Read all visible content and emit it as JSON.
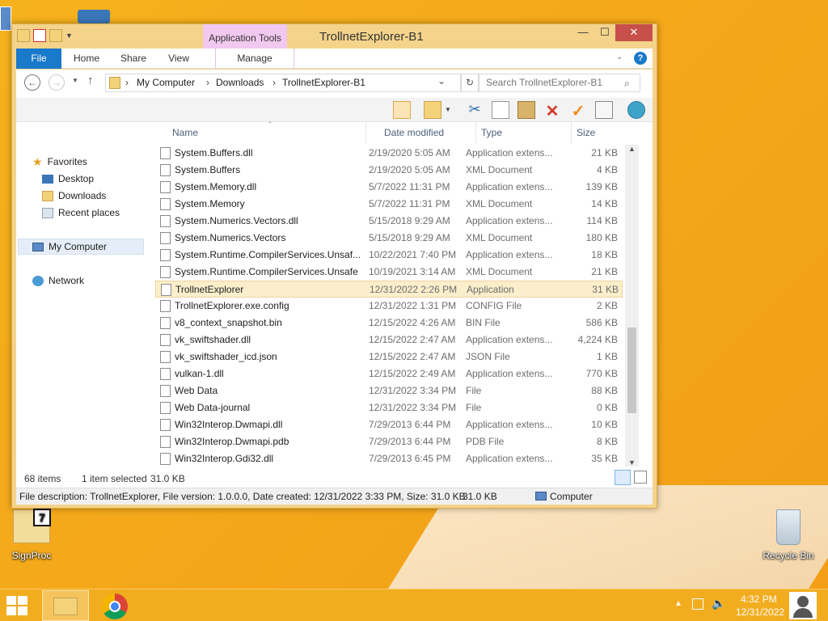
{
  "desktop": {
    "icons": [
      {
        "label": "SignProc"
      },
      {
        "label": "Recycle Bin"
      }
    ]
  },
  "window": {
    "title": "TrollnetExplorer-B1",
    "context_tab": "Application Tools",
    "ribbon_tabs": [
      "File",
      "Home",
      "Share",
      "View",
      "Manage"
    ],
    "controls": {
      "minimize": "—",
      "maximize": "☐",
      "close": "✕"
    }
  },
  "address": {
    "crumbs": [
      "My Computer",
      "Downloads",
      "TrollnetExplorer-B1"
    ],
    "search_placeholder": "Search TrollnetExplorer-B1"
  },
  "navpane": {
    "favorites": "Favorites",
    "items": [
      "Desktop",
      "Downloads",
      "Recent places"
    ],
    "computer": "My Computer",
    "network": "Network"
  },
  "columns": {
    "name": "Name",
    "date": "Date modified",
    "type": "Type",
    "size": "Size"
  },
  "files": [
    {
      "name": "System.Buffers.dll",
      "date": "2/19/2020 5:05 AM",
      "type": "Application extens...",
      "size": "21 KB"
    },
    {
      "name": "System.Buffers",
      "date": "2/19/2020 5:05 AM",
      "type": "XML Document",
      "size": "4 KB"
    },
    {
      "name": "System.Memory.dll",
      "date": "5/7/2022 11:31 PM",
      "type": "Application extens...",
      "size": "139 KB"
    },
    {
      "name": "System.Memory",
      "date": "5/7/2022 11:31 PM",
      "type": "XML Document",
      "size": "14 KB"
    },
    {
      "name": "System.Numerics.Vectors.dll",
      "date": "5/15/2018 9:29 AM",
      "type": "Application extens...",
      "size": "114 KB"
    },
    {
      "name": "System.Numerics.Vectors",
      "date": "5/15/2018 9:29 AM",
      "type": "XML Document",
      "size": "180 KB"
    },
    {
      "name": "System.Runtime.CompilerServices.Unsaf...",
      "date": "10/22/2021 7:40 PM",
      "type": "Application extens...",
      "size": "18 KB"
    },
    {
      "name": "System.Runtime.CompilerServices.Unsafe",
      "date": "10/19/2021 3:14 AM",
      "type": "XML Document",
      "size": "21 KB"
    },
    {
      "name": "TrollnetExplorer",
      "date": "12/31/2022 2:26 PM",
      "type": "Application",
      "size": "31 KB"
    },
    {
      "name": "TrollnetExplorer.exe.config",
      "date": "12/31/2022 1:31 PM",
      "type": "CONFIG File",
      "size": "2 KB"
    },
    {
      "name": "v8_context_snapshot.bin",
      "date": "12/15/2022 4:26 AM",
      "type": "BIN File",
      "size": "586 KB"
    },
    {
      "name": "vk_swiftshader.dll",
      "date": "12/15/2022 2:47 AM",
      "type": "Application extens...",
      "size": "4,224 KB"
    },
    {
      "name": "vk_swiftshader_icd.json",
      "date": "12/15/2022 2:47 AM",
      "type": "JSON File",
      "size": "1 KB"
    },
    {
      "name": "vulkan-1.dll",
      "date": "12/15/2022 2:49 AM",
      "type": "Application extens...",
      "size": "770 KB"
    },
    {
      "name": "Web Data",
      "date": "12/31/2022 3:34 PM",
      "type": "File",
      "size": "88 KB"
    },
    {
      "name": "Web Data-journal",
      "date": "12/31/2022 3:34 PM",
      "type": "File",
      "size": "0 KB"
    },
    {
      "name": "Win32Interop.Dwmapi.dll",
      "date": "7/29/2013 6:44 PM",
      "type": "Application extens...",
      "size": "10 KB"
    },
    {
      "name": "Win32Interop.Dwmapi.pdb",
      "date": "7/29/2013 6:44 PM",
      "type": "PDB File",
      "size": "8 KB"
    },
    {
      "name": "Win32Interop.Gdi32.dll",
      "date": "7/29/2013 6:45 PM",
      "type": "Application extens...",
      "size": "35 KB"
    }
  ],
  "selected_index": 8,
  "status": {
    "items": "68 items",
    "selected": "1 item selected",
    "selected_size": "31.0 KB"
  },
  "details": {
    "description": "File description: TrollnetExplorer, File version: 1.0.0.0, Date created: 12/31/2022 3:33 PM, Size: 31.0 KB",
    "size": "31.0 KB",
    "location": "Computer"
  },
  "taskbar": {
    "time": "4:32 PM",
    "date": "12/31/2022"
  },
  "colors": {
    "accent": "#1979ca",
    "selection": "#fbeecb",
    "desktop": "#f4a81a"
  }
}
